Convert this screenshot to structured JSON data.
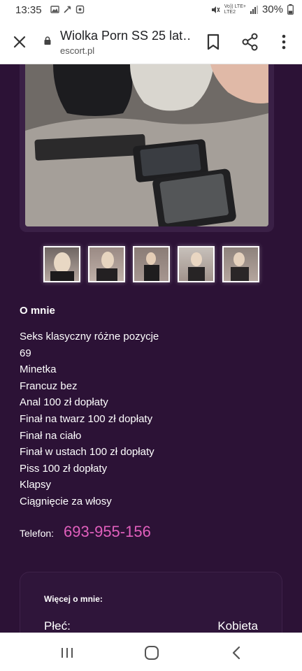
{
  "status_bar": {
    "time": "13:35",
    "network_label_top": "Vo)) LTE+",
    "network_label_bottom": "LTE2",
    "battery": "30%",
    "icons": [
      "gallery-icon",
      "tools-icon",
      "app-icon",
      "mute-icon",
      "signal-icon",
      "battery-icon"
    ]
  },
  "browser": {
    "page_title": "Wiolka Porn SS 25 lat…",
    "domain": "escort.pl",
    "icons": [
      "close-icon",
      "lock-icon",
      "bookmark-icon",
      "share-icon",
      "more-options-icon"
    ]
  },
  "profile": {
    "about_heading": "O mnie",
    "about_items": [
      "Seks klasyczny różne pozycje",
      "69",
      "Minetka",
      "Francuz bez",
      "Anal 100 zł dopłaty",
      "Finał na twarz 100 zł dopłaty",
      "Finał na ciało",
      "Finał w ustach 100 zł dopłaty",
      "Piss 100 zł dopłaty",
      "Klapsy",
      "Ciągnięcie za włosy"
    ],
    "phone_label": "Telefon:",
    "phone_number": "693-955-156",
    "more_heading": "Więcej o mnie:",
    "gender_label": "Płeć:",
    "gender_value": "Kobieta",
    "thumbnail_count": 5,
    "colors": {
      "background": "#2c1236",
      "phone_accent": "#e15fbd"
    }
  },
  "nav_bar": {
    "icons": [
      "recent-apps-icon",
      "home-icon",
      "back-icon"
    ]
  }
}
